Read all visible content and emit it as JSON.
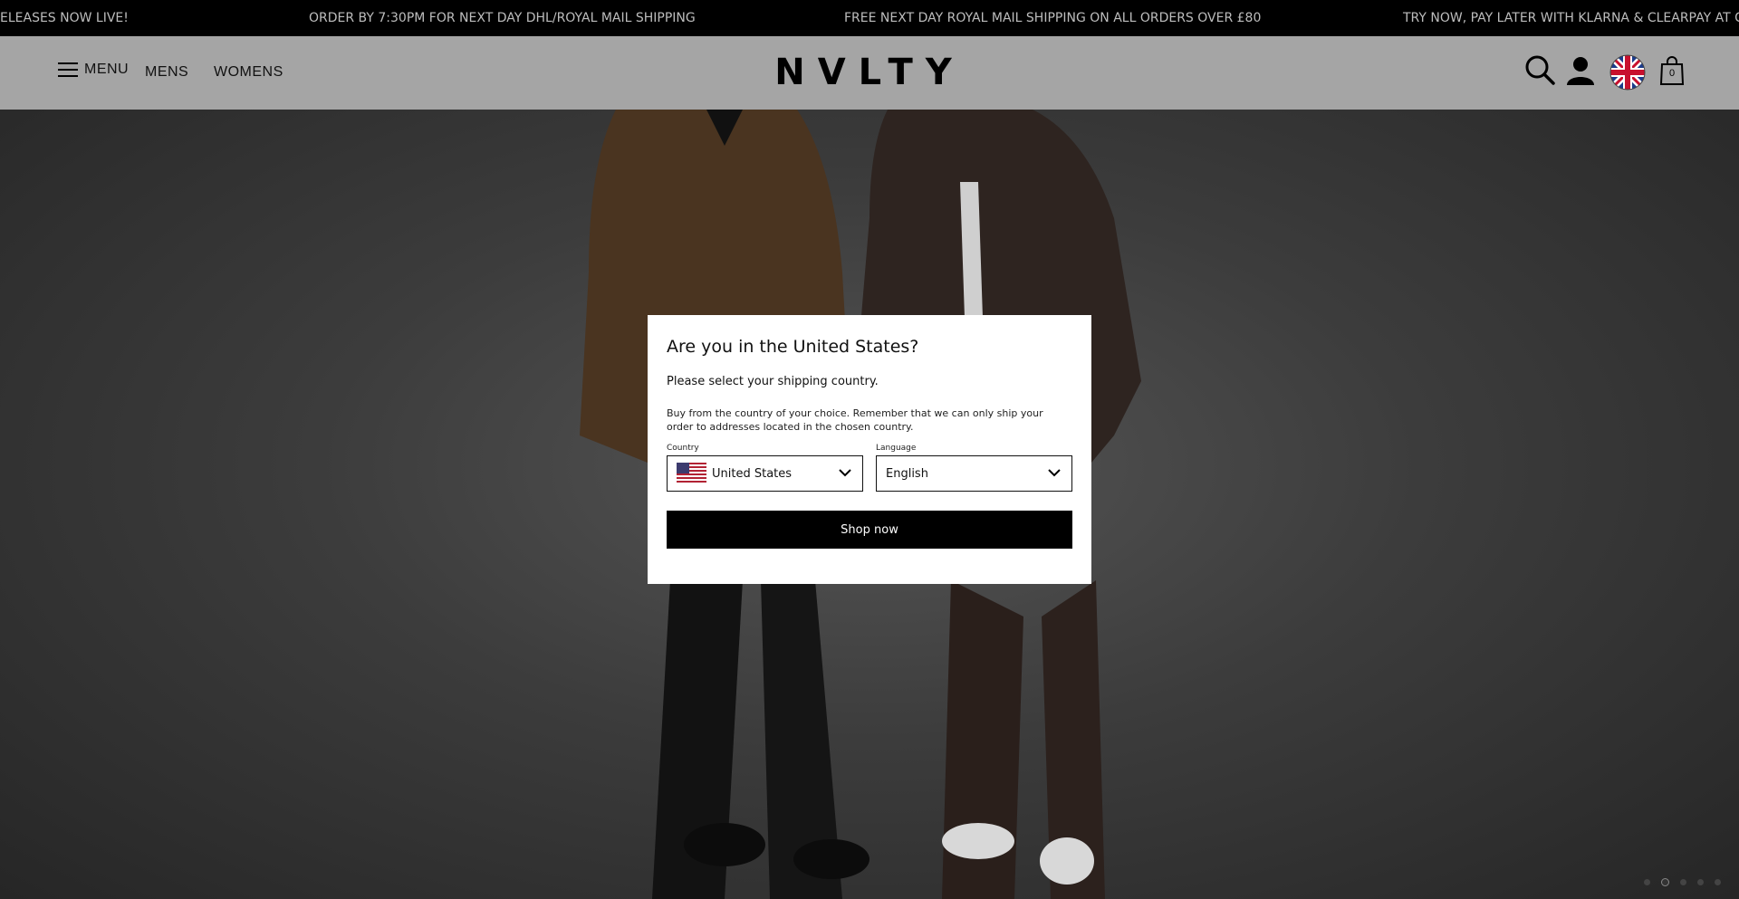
{
  "announcements": [
    "ELEASES NOW LIVE!",
    "ORDER BY 7:30PM FOR NEXT DAY DHL/ROYAL MAIL SHIPPING",
    "FREE NEXT DAY ROYAL MAIL SHIPPING ON ALL ORDERS OVER £80",
    "TRY NOW, PAY LATER WITH KLARNA & CLEARPAY AT CHECKOU"
  ],
  "header": {
    "menu_label": "MENU",
    "nav": [
      "MENS",
      "WOMENS"
    ],
    "logo": "NVLTY",
    "cart_count": "0"
  },
  "modal": {
    "title": "Are you in the United States?",
    "subtitle": "Please select your shipping country.",
    "info": "Buy from the country of your choice. Remember that we can only ship your order to addresses located in the chosen country.",
    "country_label": "Country",
    "country_value": "United States",
    "language_label": "Language",
    "language_value": "English",
    "button": "Shop now"
  },
  "carousel": {
    "slides": 5,
    "active": 2
  },
  "colors": {
    "announcement_bg": "#000000",
    "header_bg": "#a5a5a5",
    "button_bg": "#000000"
  }
}
